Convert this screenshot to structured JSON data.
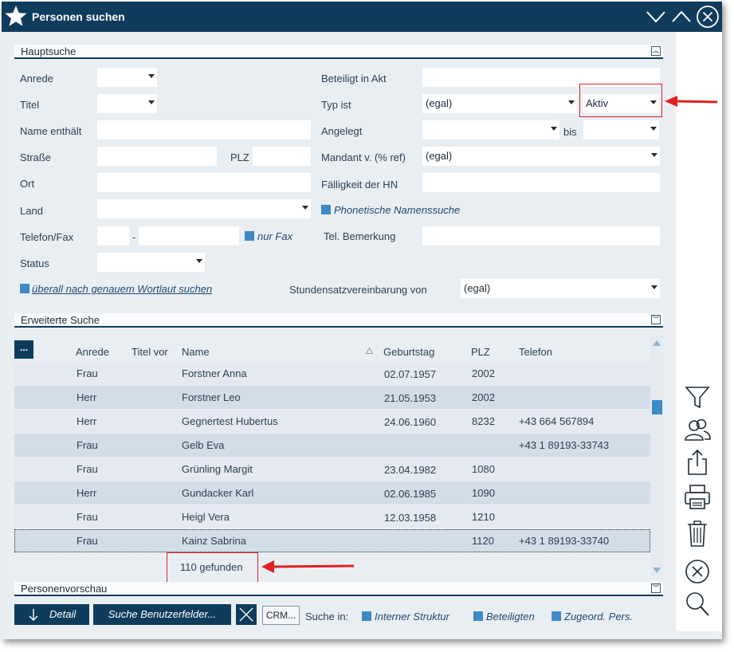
{
  "window": {
    "title": "Personen suchen"
  },
  "hauptsuche": {
    "header": "Hauptsuche",
    "labels": {
      "anrede": "Anrede",
      "titel": "Titel",
      "name_enthaelt": "Name enthält",
      "strasse": "Straße",
      "plz": "PLZ",
      "ort": "Ort",
      "land": "Land",
      "telefon_fax": "Telefon/Fax",
      "tel_sep": "-",
      "nur_fax": "nur Fax",
      "status": "Status",
      "wortlaut": "überall nach genauem Wortlaut suchen",
      "beteiligt_in_akt": "Beteiligt in Akt",
      "typ_ist": "Typ ist",
      "angelegt": "Angelegt",
      "bis": "bis",
      "mandant": "Mandant v. (% ref)",
      "faelligkeit": "Fälligkeit der HN",
      "phonetische": "Phonetische Namenssuche",
      "tel_bemerkung": "Tel. Bemerkung",
      "stundensatz": "Stundensatzvereinbarung von"
    },
    "values": {
      "typ_ist": "(egal)",
      "typ_status": "Aktiv",
      "mandant": "(egal)",
      "stundensatz": "(egal)"
    }
  },
  "erweiterte": {
    "header": "Erweiterte Suche"
  },
  "grid": {
    "menu_button": "...",
    "columns": [
      "Anrede",
      "Titel vor",
      "Name",
      "Geburtstag",
      "PLZ",
      "Telefon"
    ],
    "rows": [
      {
        "anrede": "Frau",
        "titel": "",
        "name": "Forstner Anna",
        "geburtstag": "02.07.1957",
        "plz": "2002",
        "telefon": ""
      },
      {
        "anrede": "Herr",
        "titel": "",
        "name": "Forstner Leo",
        "geburtstag": "21.05.1953",
        "plz": "2002",
        "telefon": ""
      },
      {
        "anrede": "Herr",
        "titel": "",
        "name": "Gegnertest Hubertus",
        "geburtstag": "24.06.1960",
        "plz": "8232",
        "telefon": "+43 664 567894"
      },
      {
        "anrede": "Frau",
        "titel": "",
        "name": "Gelb Eva",
        "geburtstag": "",
        "plz": "",
        "telefon": "+43 1 89193-33743"
      },
      {
        "anrede": "Frau",
        "titel": "",
        "name": "Grünling Margit",
        "geburtstag": "23.04.1982",
        "plz": "1080",
        "telefon": ""
      },
      {
        "anrede": "Herr",
        "titel": "",
        "name": "Gundacker Karl",
        "geburtstag": "02.06.1985",
        "plz": "1090",
        "telefon": ""
      },
      {
        "anrede": "Frau",
        "titel": "",
        "name": "Heigl Vera",
        "geburtstag": "12.03.1958",
        "plz": "1210",
        "telefon": ""
      },
      {
        "anrede": "Frau",
        "titel": "",
        "name": "Kainz Sabrina",
        "geburtstag": "",
        "plz": "1120",
        "telefon": "+43 1 89193-33740"
      }
    ],
    "found": "110 gefunden"
  },
  "vorschau": {
    "header": "Personenvorschau"
  },
  "footer": {
    "detail": "Detail",
    "suche_felder": "Suche Benutzerfelder...",
    "crm": "CRM...",
    "suche_in": "Suche in:",
    "interne": "Interner Struktur",
    "beteiligten": "Beteiligten",
    "zugeord": "Zugeord. Pers."
  },
  "sidebar_icons": [
    "filter-icon",
    "persons-icon",
    "export-icon",
    "print-icon",
    "trash-icon",
    "close-circle-icon",
    "search-icon"
  ],
  "colors": {
    "accent": "#0f3c5c",
    "checkbox": "#3e8ac4",
    "highlight": "#e02020"
  }
}
